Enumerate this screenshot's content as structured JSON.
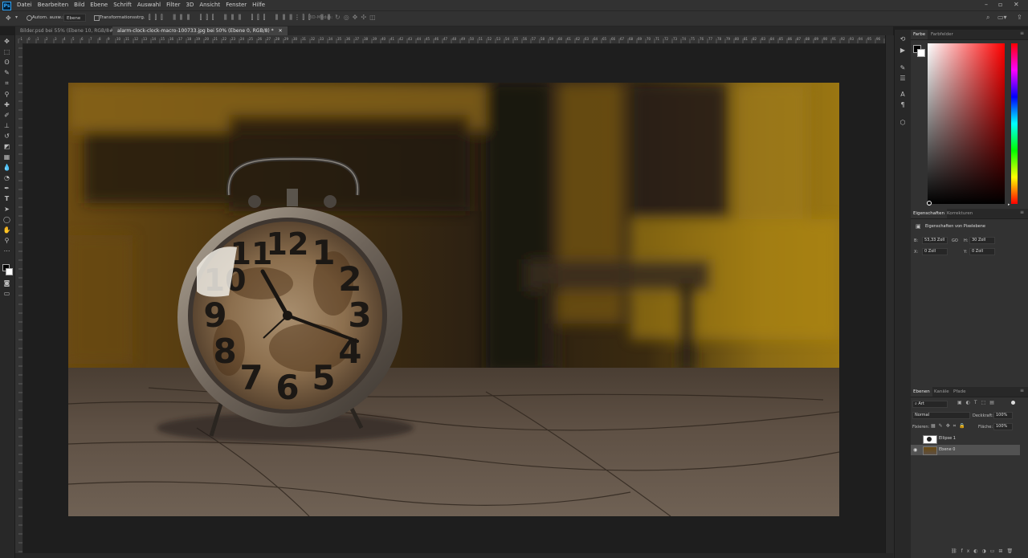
{
  "app": {
    "logo_text": "Ps"
  },
  "menu": [
    "Datei",
    "Bearbeiten",
    "Bild",
    "Ebene",
    "Schrift",
    "Auswahl",
    "Filter",
    "3D",
    "Ansicht",
    "Fenster",
    "Hilfe"
  ],
  "window_controls": [
    "–",
    "▫",
    "✕"
  ],
  "options": {
    "auto_select_label": "Autom. ausw.:",
    "auto_select_value": "Ebene",
    "transform_label": "Transformationsstrg.",
    "mode_3d_label": "3D-Modus:"
  },
  "tabs": [
    {
      "label": "Bilder.psd bei 55% (Ebene 10, RGB/8#) *",
      "close": "✕"
    },
    {
      "label": "alarm-clock-clock-macro-100733.jpg bei 50% (Ebene 0, RGB/8) *",
      "close": "✕"
    }
  ],
  "ruler_ticks": [
    "-1",
    "0",
    "1",
    "2",
    "3",
    "4",
    "5",
    "6",
    "7",
    "8",
    "9",
    "10",
    "11",
    "12",
    "13",
    "14",
    "15",
    "16",
    "17",
    "18",
    "19",
    "20",
    "21",
    "22",
    "23",
    "24",
    "25",
    "26",
    "27",
    "28",
    "29",
    "30",
    "31",
    "32",
    "33",
    "34",
    "35",
    "36",
    "37",
    "38",
    "39",
    "40",
    "41",
    "42",
    "43",
    "44",
    "45",
    "46",
    "47",
    "48",
    "49",
    "50",
    "51",
    "52",
    "53",
    "54",
    "55",
    "56",
    "57",
    "58",
    "59",
    "60",
    "61",
    "62",
    "63",
    "64",
    "65",
    "66",
    "67",
    "68",
    "69",
    "70",
    "71",
    "72",
    "73",
    "74",
    "75",
    "76",
    "77",
    "78",
    "79",
    "80",
    "81",
    "82",
    "83",
    "84",
    "85",
    "86",
    "87",
    "88",
    "89",
    "90",
    "91",
    "92",
    "93",
    "94",
    "95",
    "96",
    "97",
    "98",
    "99",
    "100"
  ],
  "clock": {
    "numbers": [
      "12",
      "1",
      "2",
      "3",
      "4",
      "5",
      "6",
      "7",
      "8",
      "9",
      "10",
      "11"
    ]
  },
  "color_panel": {
    "tabs": [
      "Farbe",
      "Farbfelder"
    ],
    "foreground": "#000000",
    "background": "#ffffff",
    "hue": "#ff0000"
  },
  "properties_panel": {
    "tabs": [
      "Eigenschaften",
      "Korrekturen"
    ],
    "subtitle": "Eigenschaften von Pixelebene",
    "b_label": "B:",
    "b_value": "53,33 Zoll",
    "link_icon": "GO",
    "h_label": "H:",
    "h_value": "30 Zoll",
    "x_label": "X:",
    "x_value": "0 Zoll",
    "y_label": "Y:",
    "y_value": "0 Zoll"
  },
  "layers_panel": {
    "tabs": [
      "Ebenen",
      "Kanäle",
      "Pfade"
    ],
    "filter_value": "Art",
    "blend_mode": "Normal",
    "opacity_label": "Deckkraft:",
    "opacity_value": "100%",
    "lock_label": "Fixieren:",
    "fill_label": "Fläche:",
    "fill_value": "100%",
    "layers": [
      {
        "name": "Ellipse 1",
        "visible": false,
        "selected": false
      },
      {
        "name": "Ebene 0",
        "visible": true,
        "selected": true
      }
    ]
  }
}
